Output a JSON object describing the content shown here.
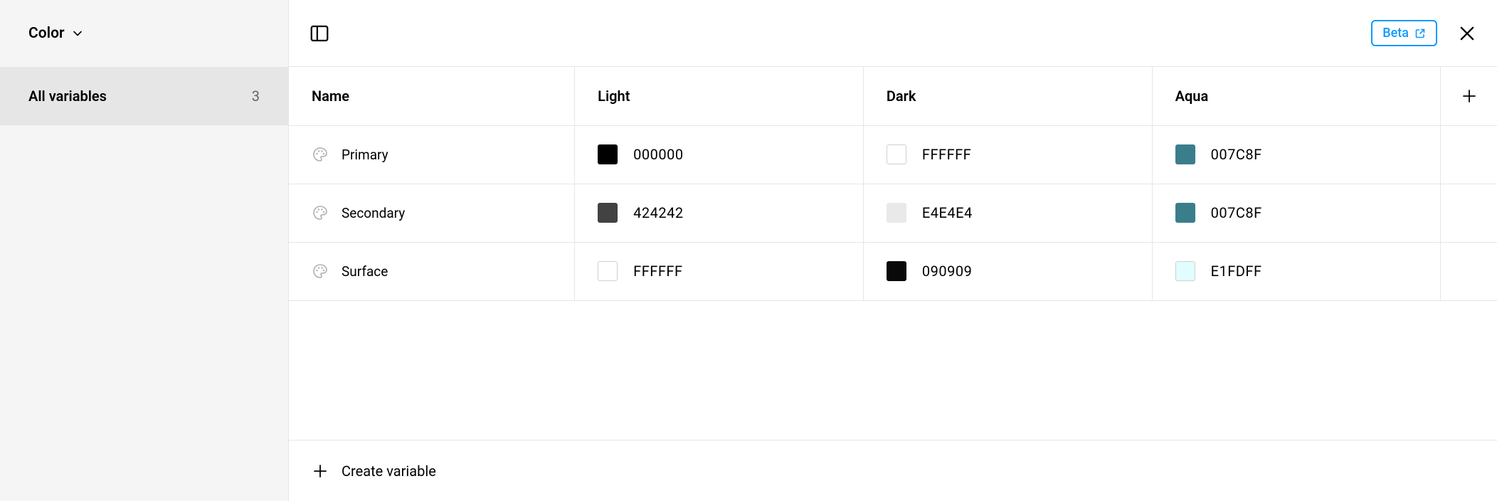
{
  "sidebar": {
    "collection_label": "Color",
    "groups": [
      {
        "label": "All variables",
        "count": "3"
      }
    ]
  },
  "toolbar": {
    "beta_label": "Beta"
  },
  "table": {
    "columns": {
      "name": "Name",
      "modes": [
        "Light",
        "Dark",
        "Aqua"
      ]
    },
    "rows": [
      {
        "name": "Primary",
        "cells": [
          {
            "hex": "000000",
            "swatch": "#000000",
            "outline": false
          },
          {
            "hex": "FFFFFF",
            "swatch": "#FFFFFF",
            "outline": true
          },
          {
            "hex": "007C8F",
            "swatch": "#3A7E8C",
            "outline": false
          }
        ]
      },
      {
        "name": "Secondary",
        "cells": [
          {
            "hex": "424242",
            "swatch": "#424242",
            "outline": false
          },
          {
            "hex": "E4E4E4",
            "swatch": "#E9E9E9",
            "outline": false
          },
          {
            "hex": "007C8F",
            "swatch": "#3A7E8C",
            "outline": false
          }
        ]
      },
      {
        "name": "Surface",
        "cells": [
          {
            "hex": "FFFFFF",
            "swatch": "#FFFFFF",
            "outline": true
          },
          {
            "hex": "090909",
            "swatch": "#090909",
            "outline": false
          },
          {
            "hex": "E1FDFF",
            "swatch": "#E1FDFF",
            "outline": true
          }
        ]
      }
    ]
  },
  "footer": {
    "create_label": "Create variable"
  }
}
